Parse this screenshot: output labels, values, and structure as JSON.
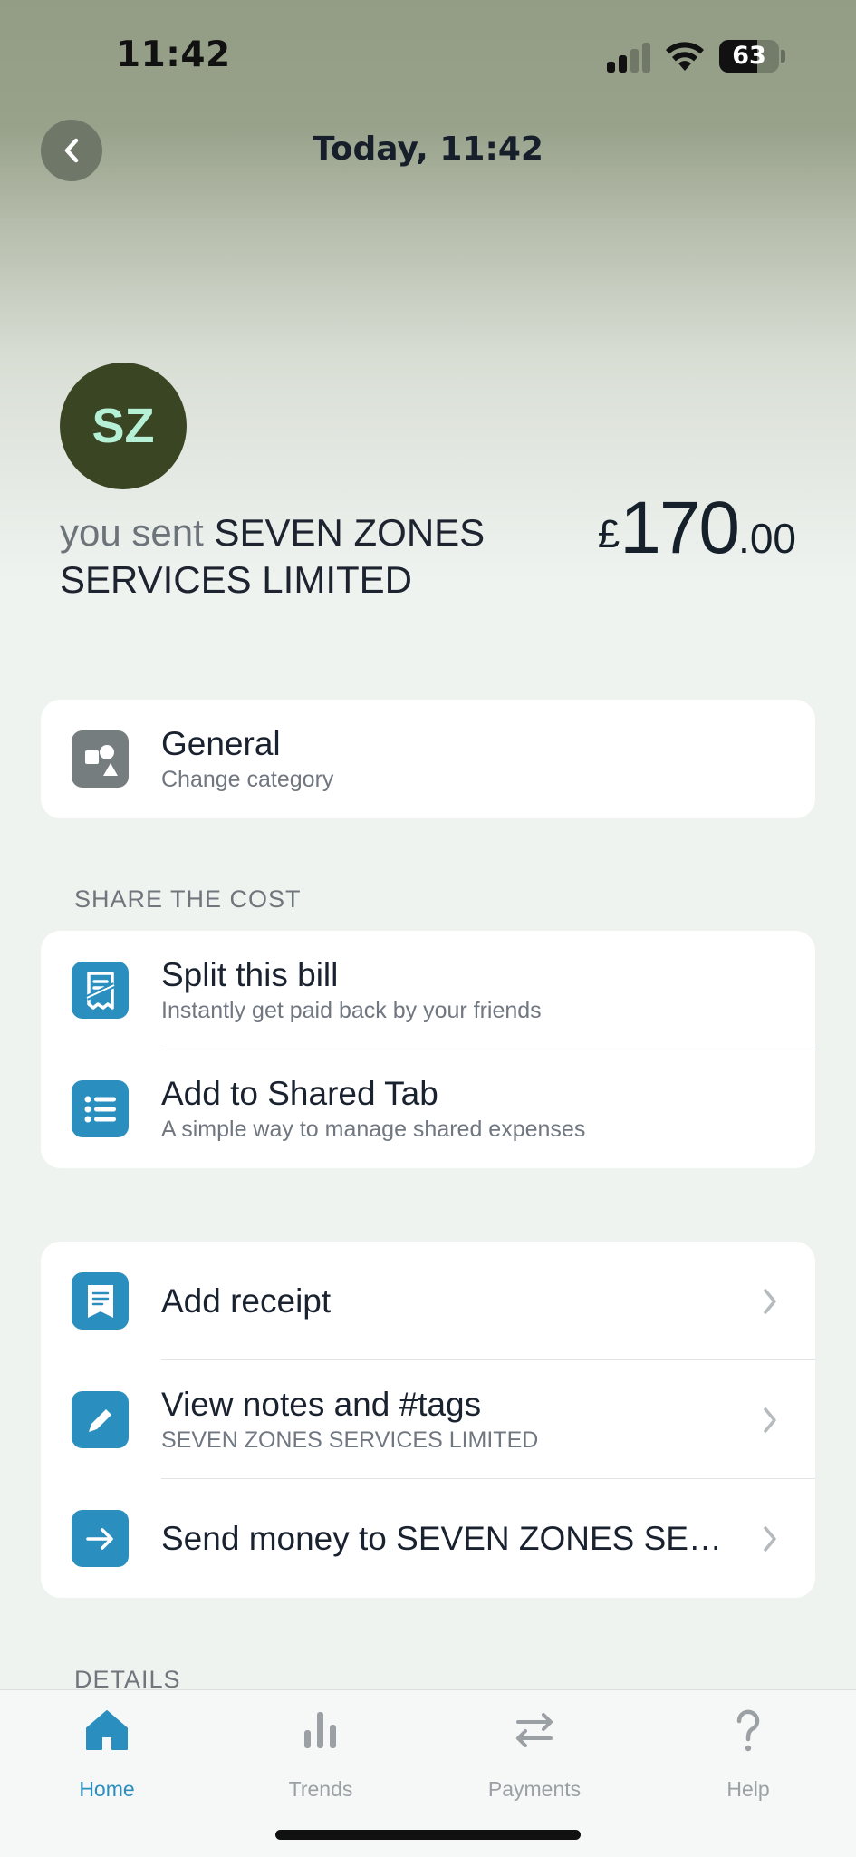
{
  "status_bar": {
    "time": "11:42",
    "battery": "63",
    "signal_bars_on": 2,
    "signal_bars_total": 4
  },
  "nav": {
    "title": "Today, 11:42",
    "back_icon": "chevron-left-icon"
  },
  "merchant": {
    "initials": "SZ",
    "prefix": "you sent",
    "name": "SEVEN ZONES SERVICES LIMITED"
  },
  "amount": {
    "currency": "£",
    "major": "170",
    "minor": ".00"
  },
  "category": {
    "title": "General",
    "subtitle": "Change category",
    "icon": "shapes-icon"
  },
  "share_section": {
    "label": "SHARE THE COST",
    "items": [
      {
        "title": "Split this bill",
        "subtitle": "Instantly get paid back by your friends",
        "icon": "receipt-split-icon"
      },
      {
        "title": "Add to Shared Tab",
        "subtitle": "A simple way to manage shared expenses",
        "icon": "list-icon"
      }
    ]
  },
  "actions": {
    "items": [
      {
        "title": "Add receipt",
        "subtitle": "",
        "icon": "receipt-icon"
      },
      {
        "title": "View notes and #tags",
        "subtitle": "SEVEN ZONES SERVICES LIMITED",
        "icon": "pencil-icon"
      },
      {
        "title": "Send money to SEVEN ZONES SE…",
        "subtitle": "",
        "icon": "arrow-right-icon"
      }
    ]
  },
  "details_section": {
    "label": "DETAILS"
  },
  "tab_bar": {
    "tabs": [
      {
        "label": "Home",
        "icon": "home-icon",
        "active": true
      },
      {
        "label": "Trends",
        "icon": "bar-chart-icon",
        "active": false
      },
      {
        "label": "Payments",
        "icon": "transfer-arrows-icon",
        "active": false
      },
      {
        "label": "Help",
        "icon": "question-icon",
        "active": false
      }
    ]
  },
  "colors": {
    "accent": "#2a8fbf",
    "avatar_bg": "#3a4523",
    "avatar_text": "#b6f0d6",
    "category_icon_bg": "#767d7e"
  }
}
